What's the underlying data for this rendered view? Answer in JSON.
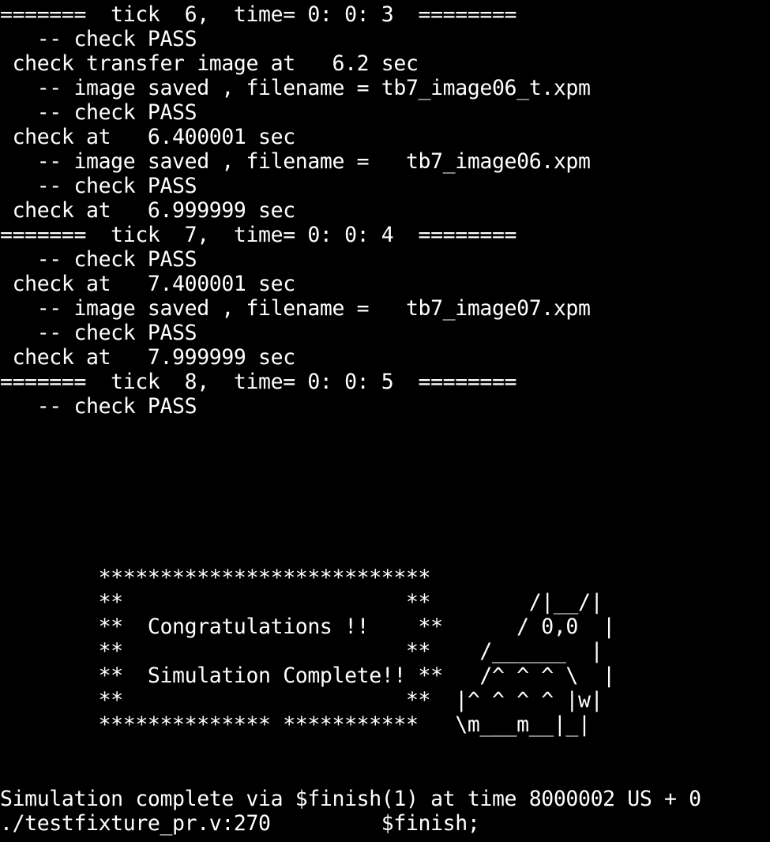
{
  "terminal": {
    "top_lines": [
      "=======  tick  6,  time= 0: 0: 3  ========",
      "   -- check PASS",
      " check transfer image at   6.2 sec",
      "   -- image saved , filename = tb7_image06_t.xpm",
      "   -- check PASS",
      " check at   6.400001 sec",
      "   -- image saved , filename =   tb7_image06.xpm",
      "   -- check PASS",
      " check at   6.999999 sec",
      "=======  tick  7,  time= 0: 0: 4  ========",
      "   -- check PASS",
      " check at   7.400001 sec",
      "   -- image saved , filename =   tb7_image07.xpm",
      "   -- check PASS",
      " check at   7.999999 sec",
      "=======  tick  8,  time= 0: 0: 5  ========",
      "   -- check PASS"
    ],
    "art_lines": [
      "        ***************************",
      "        **                       **        /|__/|",
      "        **  Congratulations !!    **      / 0,0  |",
      "        **                       **    /______  |",
      "        **  Simulation Complete!! **   /^ ^ ^ \\  |",
      "        **                       **  |^ ^ ^ ^ |w|",
      "        ************** ***********   \\m___m__|_|"
    ],
    "bottom_lines": [
      "Simulation complete via $finish(1) at time 8000002 US + 0",
      "./testfixture_pr.v:270         $finish;"
    ],
    "colors": {
      "background": "#000000",
      "text": "#ffffff"
    }
  }
}
